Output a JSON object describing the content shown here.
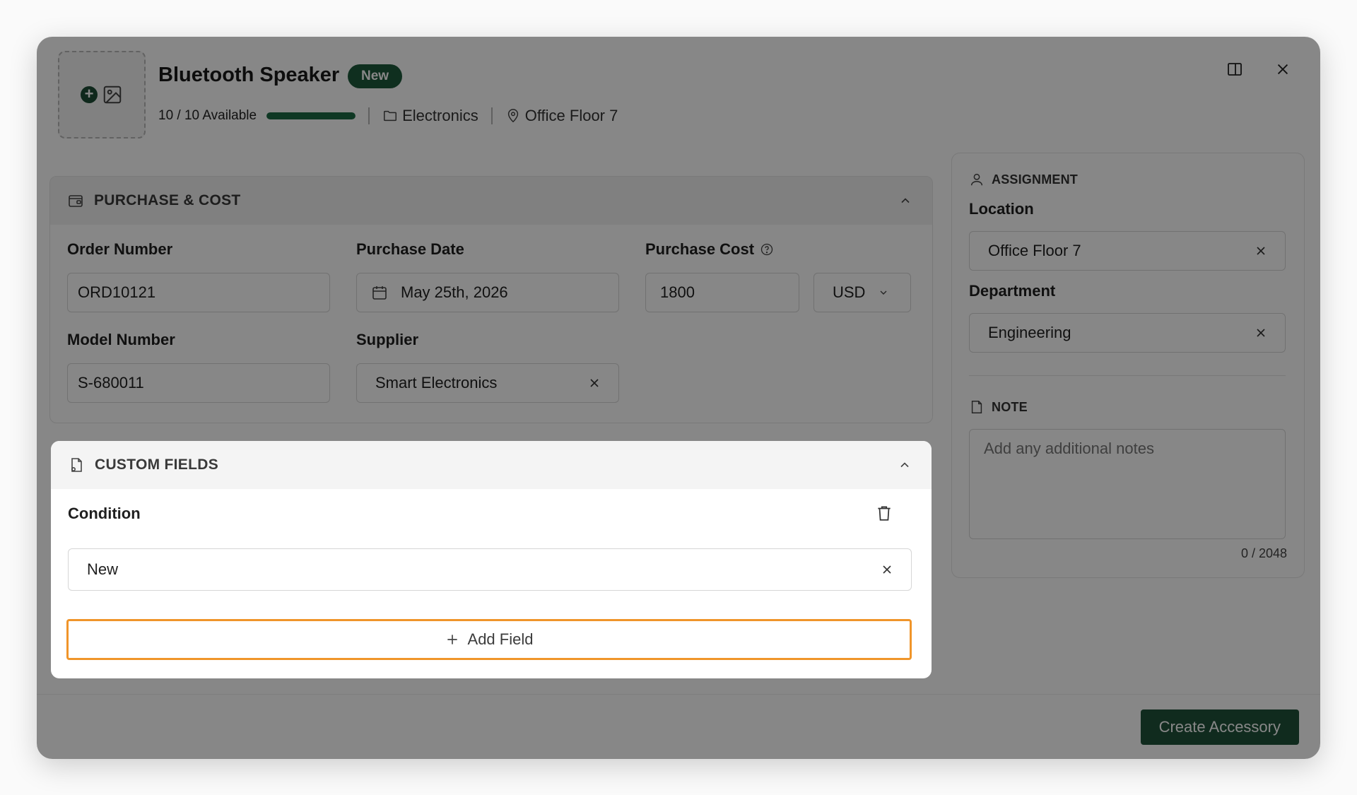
{
  "header": {
    "title": "Bluetooth Speaker",
    "badge": "New",
    "availability": "10 / 10 Available",
    "availability_fraction": 1.0,
    "category": "Electronics",
    "location": "Office Floor 7"
  },
  "purchase": {
    "section_title": "PURCHASE & COST",
    "order_number_label": "Order Number",
    "order_number_value": "ORD10121",
    "purchase_date_label": "Purchase Date",
    "purchase_date_value": "May 25th, 2026",
    "purchase_cost_label": "Purchase Cost",
    "purchase_cost_value": "1800",
    "currency": "USD",
    "model_number_label": "Model Number",
    "model_number_value": "S-680011",
    "supplier_label": "Supplier",
    "supplier_value": "Smart Electronics"
  },
  "custom_fields": {
    "section_title": "CUSTOM FIELDS",
    "condition_label": "Condition",
    "condition_value": "New",
    "add_field_label": "Add Field"
  },
  "assignment": {
    "section_title": "ASSIGNMENT",
    "location_label": "Location",
    "location_value": "Office Floor 7",
    "department_label": "Department",
    "department_value": "Engineering"
  },
  "note": {
    "section_title": "NOTE",
    "placeholder": "Add any additional notes",
    "counter": "0 / 2048"
  },
  "footer": {
    "create_label": "Create Accessory"
  },
  "colors": {
    "brand": "#1f5239",
    "focus": "#f0952a"
  }
}
